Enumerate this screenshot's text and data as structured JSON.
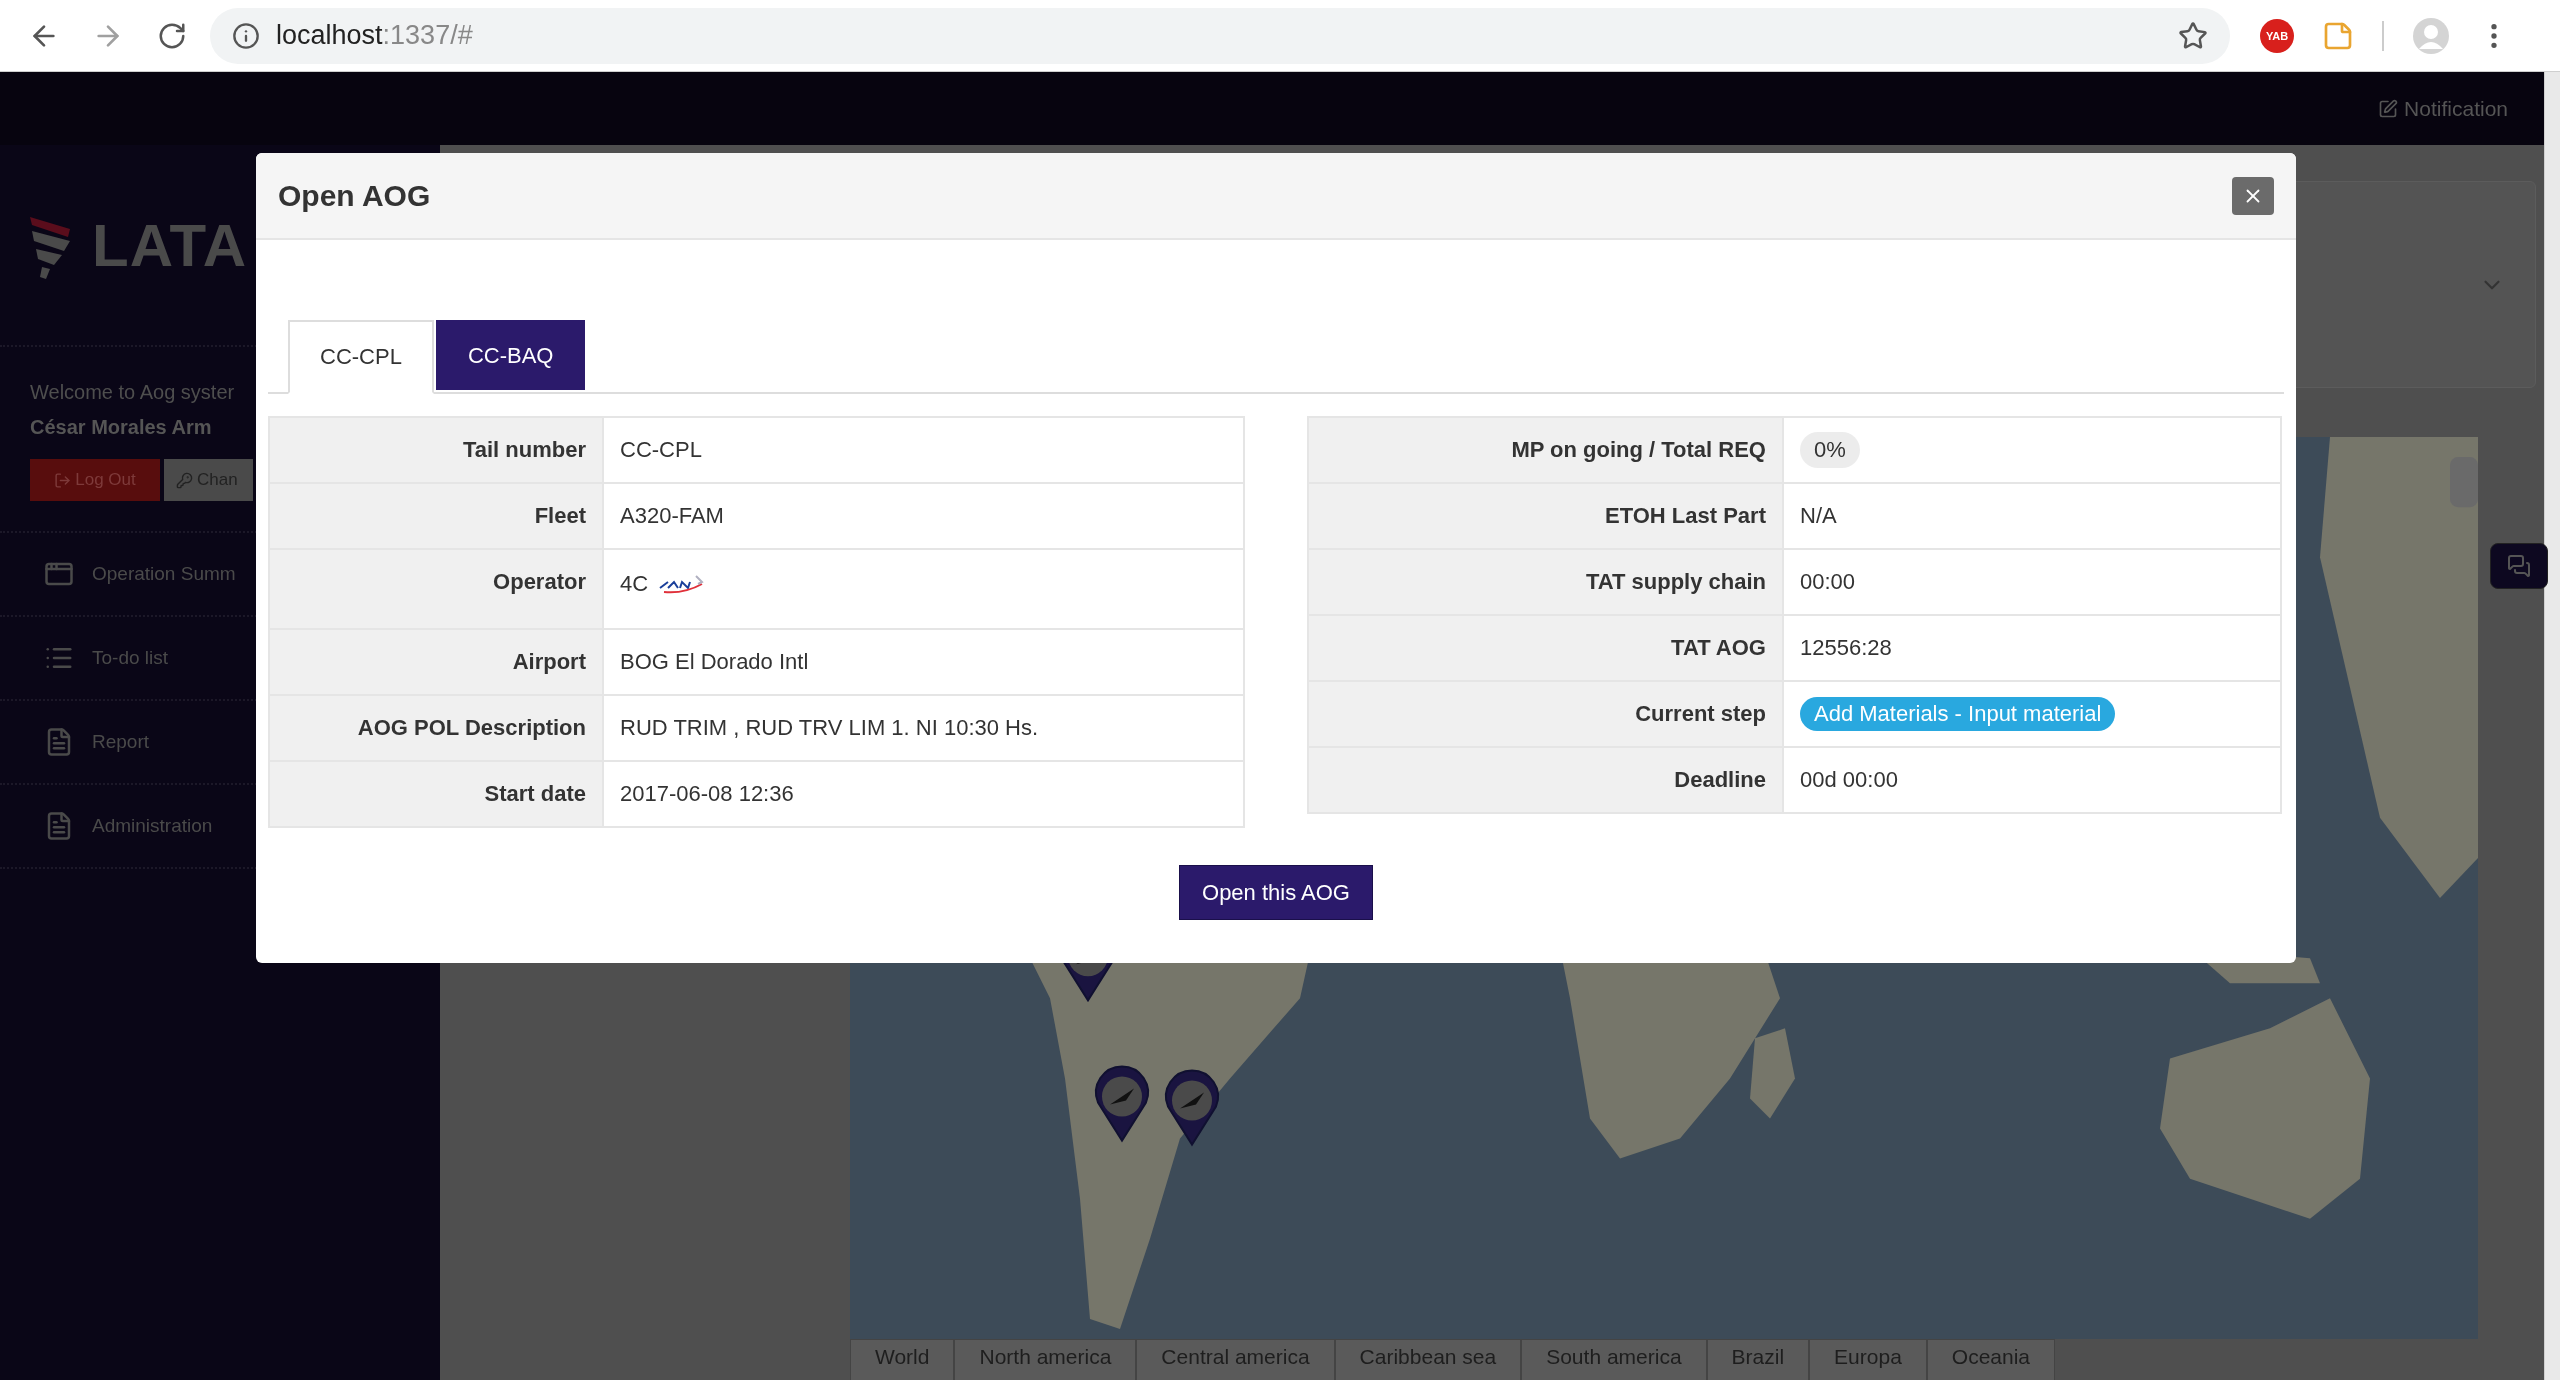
{
  "browser": {
    "url_host": "localhost",
    "url_rest": ":1337/#",
    "extension_badge": "YAB"
  },
  "app": {
    "notification": "Notification",
    "logo_text": "LATA",
    "welcome": "Welcome to Aog syster",
    "user": "César Morales Arm",
    "logout": "Log Out",
    "change": "Chan",
    "menu": [
      {
        "label": "Operation Summ",
        "kind": "window"
      },
      {
        "label": "To-do list",
        "kind": "list"
      },
      {
        "label": "Report",
        "kind": "doc"
      },
      {
        "label": "Administration",
        "kind": "doc"
      }
    ],
    "regions": [
      {
        "label": "World"
      },
      {
        "label": "North america"
      },
      {
        "label": "Central america"
      },
      {
        "label": "Caribbean sea"
      },
      {
        "label": "South america"
      },
      {
        "label": "Brazil"
      },
      {
        "label": "Europa"
      },
      {
        "label": "Oceania"
      }
    ]
  },
  "modal": {
    "title": "Open AOG",
    "tabs": [
      {
        "label": "CC-CPL",
        "selected": true
      },
      {
        "label": "CC-BAQ",
        "selected": false
      }
    ],
    "left": [
      {
        "label": "Tail number",
        "value": "CC-CPL",
        "kind": "text"
      },
      {
        "label": "Fleet",
        "value": "A320-FAM",
        "kind": "text"
      },
      {
        "label": "Operator",
        "value": "4C",
        "kind": "operator"
      },
      {
        "label": "Airport",
        "value": "BOG El Dorado Intl",
        "kind": "text"
      },
      {
        "label": "AOG POL Description",
        "value": "RUD TRIM , RUD TRV LIM 1. NI 10:30 Hs.",
        "kind": "text"
      },
      {
        "label": "Start date",
        "value": "2017-06-08 12:36",
        "kind": "text"
      }
    ],
    "right": [
      {
        "label": "MP on going / Total REQ",
        "value": "0%",
        "kind": "badge"
      },
      {
        "label": "ETOH Last Part",
        "value": "N/A",
        "kind": "text"
      },
      {
        "label": "TAT supply chain",
        "value": "00:00",
        "kind": "text"
      },
      {
        "label": "TAT AOG",
        "value": "12556:28",
        "kind": "text"
      },
      {
        "label": "Current step",
        "value": "Add Materials - Input material",
        "kind": "pill"
      },
      {
        "label": "Deadline",
        "value": "00d 00:00",
        "kind": "text"
      }
    ],
    "action": "Open this AOG"
  }
}
